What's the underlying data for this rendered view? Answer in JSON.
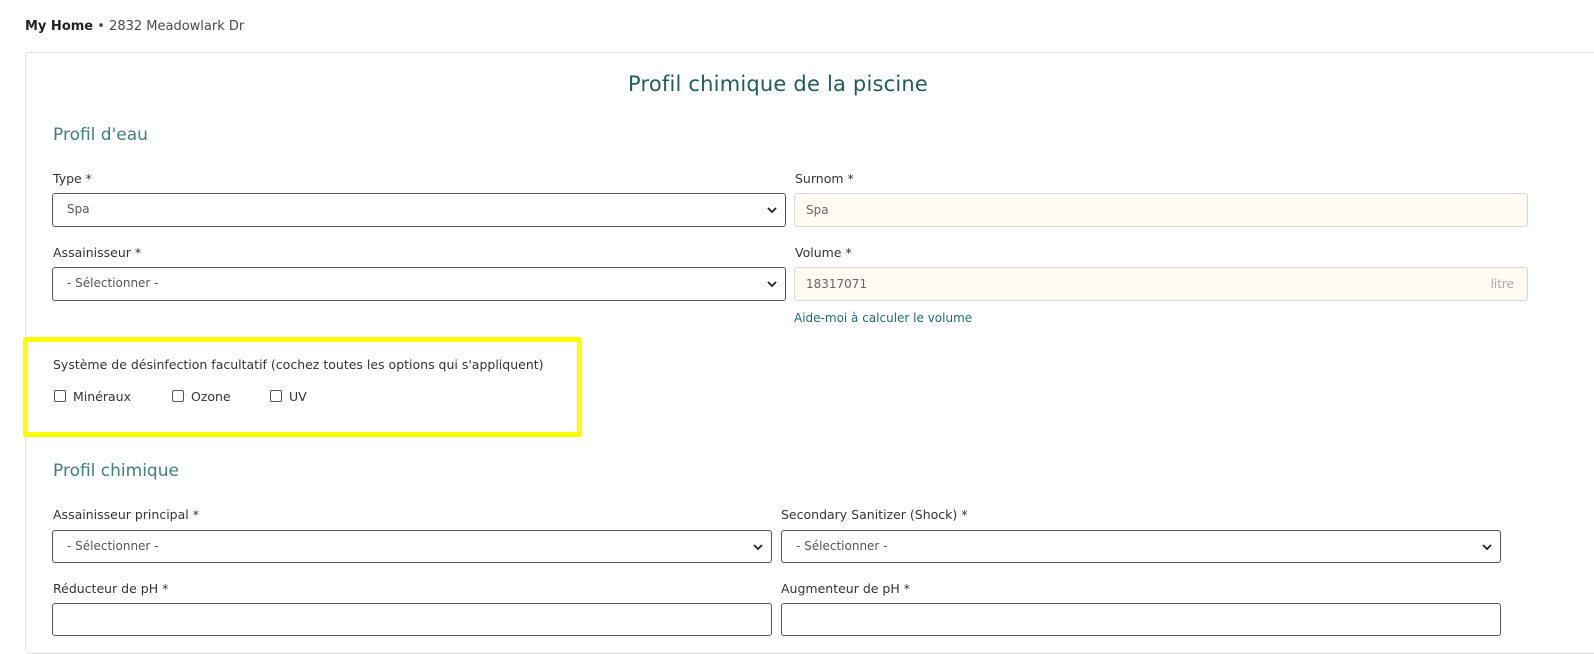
{
  "breadcrumb": {
    "home": "My Home",
    "separator": " • ",
    "address": "2832 Meadowlark Dr"
  },
  "page_title": "Profil chimique de la piscine",
  "water_profile": {
    "title": "Profil d'eau",
    "type": {
      "label": "Type *",
      "value": "Spa"
    },
    "nickname": {
      "label": "Surnom *",
      "value": "Spa"
    },
    "sanitizer": {
      "label": "Assainisseur *",
      "value": "- Sélectionner -"
    },
    "volume": {
      "label": "Volume *",
      "value": "18317071",
      "unit": "litre"
    },
    "volume_help_link": "Aide-moi à calculer le volume",
    "optional_disinfection": {
      "label": "Système de désinfection facultatif (cochez toutes les options qui s'appliquent)",
      "options": [
        {
          "label": "Minéraux",
          "checked": false
        },
        {
          "label": "Ozone",
          "checked": false
        },
        {
          "label": "UV",
          "checked": false
        }
      ]
    }
  },
  "chemical_profile": {
    "title": "Profil chimique",
    "main_sanitizer": {
      "label": "Assainisseur principal *",
      "value": "- Sélectionner -"
    },
    "secondary_sanitizer": {
      "label": "Secondary Sanitizer (Shock) *",
      "value": "- Sélectionner -"
    },
    "ph_reducer": {
      "label": "Réducteur de pH *"
    },
    "ph_increaser": {
      "label": "Augmenteur de pH *"
    }
  },
  "colors": {
    "title": "#1f5c5c",
    "section_title": "#3f7f7f",
    "link": "#1f6b6b",
    "highlight": "#fbff00",
    "input_bg": "#fffaf2"
  },
  "icons": {
    "select_arrow": "chevron-down-icon"
  }
}
